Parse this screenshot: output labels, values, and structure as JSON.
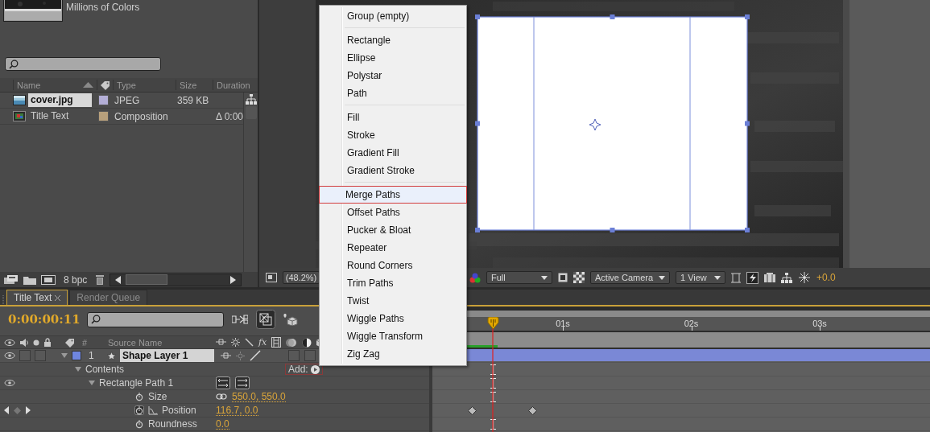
{
  "project": {
    "thumbnail_info": "Millions of Colors",
    "columns": [
      {
        "label": "Name"
      },
      {
        "label": "Type"
      },
      {
        "label": "Size"
      },
      {
        "label": "Duration"
      }
    ],
    "items": [
      {
        "kind": "footage",
        "name": "cover.jpg",
        "color": "#b3aed6",
        "type": "JPEG",
        "size": "359 KB",
        "selected": true
      },
      {
        "kind": "composition",
        "name": "Title Text",
        "color": "#b8a07c",
        "type": "Composition",
        "duration": "Δ 0:00",
        "selected": false
      }
    ],
    "bit_depth": "8 bpc"
  },
  "viewer": {
    "zoom": "(48.2%)",
    "resolution": "Full",
    "camera": "Active Camera",
    "views": "1 View",
    "exposure": "+0.0"
  },
  "context_menu": {
    "groups": [
      {
        "items": [
          {
            "label": "Group (empty)",
            "selected": false
          }
        ]
      },
      {
        "items": [
          {
            "label": "Rectangle",
            "selected": false
          },
          {
            "label": "Ellipse",
            "selected": false
          },
          {
            "label": "Polystar",
            "selected": false
          },
          {
            "label": "Path",
            "selected": false
          }
        ]
      },
      {
        "items": [
          {
            "label": "Fill",
            "selected": false
          },
          {
            "label": "Stroke",
            "selected": false
          },
          {
            "label": "Gradient Fill",
            "selected": false
          },
          {
            "label": "Gradient Stroke",
            "selected": false
          }
        ]
      },
      {
        "items": [
          {
            "label": "Merge Paths",
            "selected": true
          },
          {
            "label": "Offset Paths",
            "selected": false
          },
          {
            "label": "Pucker & Bloat",
            "selected": false
          },
          {
            "label": "Repeater",
            "selected": false
          },
          {
            "label": "Round Corners",
            "selected": false
          },
          {
            "label": "Trim Paths",
            "selected": false
          },
          {
            "label": "Twist",
            "selected": false
          },
          {
            "label": "Wiggle Paths",
            "selected": false
          },
          {
            "label": "Wiggle Transform",
            "selected": false
          },
          {
            "label": "Zig Zag",
            "selected": false
          }
        ]
      }
    ]
  },
  "timeline": {
    "tabs": [
      {
        "label": "Title Text",
        "selected": true
      },
      {
        "label": "Render Queue",
        "selected": false
      }
    ],
    "timecode": "0:00:00:11",
    "columns": [
      {
        "label": "#"
      },
      {
        "label": "Source Name"
      }
    ],
    "effects_label": "fx",
    "ruler": [
      "01s",
      "02s",
      "03s"
    ],
    "layers": [
      {
        "kind": "layer",
        "number": "1",
        "name": "Shape Layer 1",
        "color": "#6f86e0",
        "visible": true,
        "expanded": true,
        "selected": true,
        "children": [
          {
            "kind": "group",
            "name": "Contents",
            "expanded": true,
            "add_button": "Add:",
            "children": [
              {
                "kind": "group",
                "name": "Rectangle Path 1",
                "expanded": true,
                "visible": true,
                "children": [
                  {
                    "kind": "property",
                    "name": "Size",
                    "value": "550.0, 550.0",
                    "linked": true,
                    "animated": false
                  },
                  {
                    "kind": "property",
                    "name": "Position",
                    "value": "116.7, 0.0",
                    "linked": false,
                    "animated": true
                  },
                  {
                    "kind": "property",
                    "name": "Roundness",
                    "value": "0.0",
                    "linked": false,
                    "animated": false
                  }
                ]
              }
            ]
          }
        ]
      }
    ]
  }
}
